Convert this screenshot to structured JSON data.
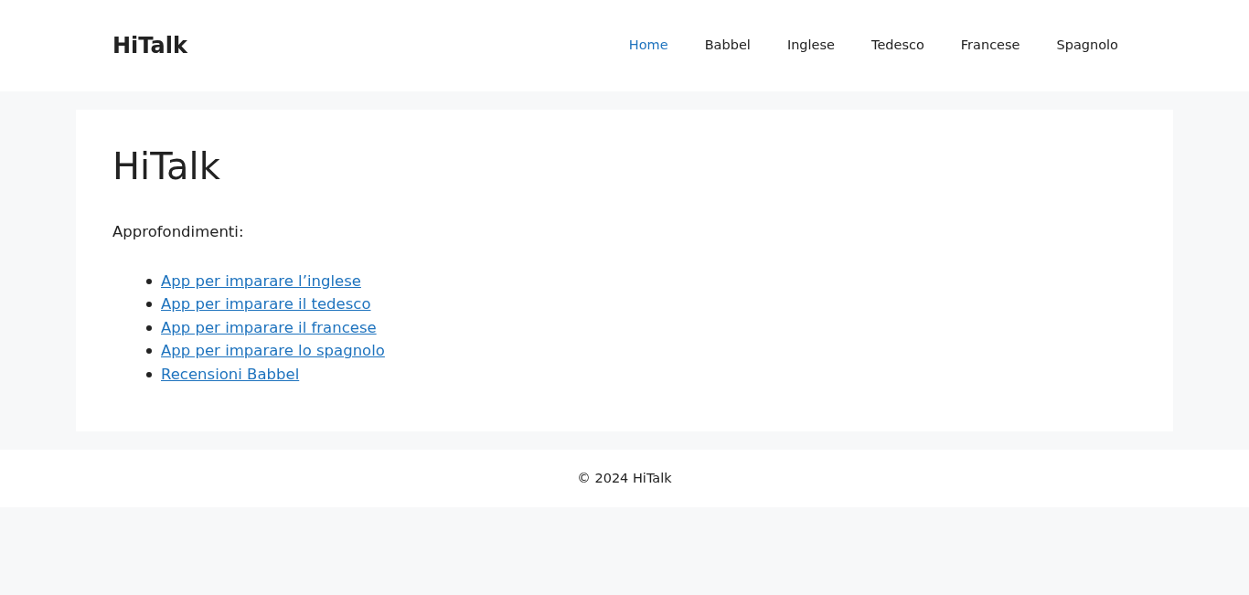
{
  "header": {
    "logo": "HiTalk",
    "nav": [
      {
        "label": "Home",
        "selected": true
      },
      {
        "label": "Babbel",
        "selected": false
      },
      {
        "label": "Inglese",
        "selected": false
      },
      {
        "label": "Tedesco",
        "selected": false
      },
      {
        "label": "Francese",
        "selected": false
      },
      {
        "label": "Spagnolo",
        "selected": false
      }
    ]
  },
  "content": {
    "title": "HiTalk",
    "intro": "Approfondimenti:",
    "links": [
      "App per imparare l’inglese",
      "App per imparare il tedesco",
      "App per imparare il francese",
      "App per imparare lo spagnolo",
      "Recensioni Babbel"
    ]
  },
  "footer": {
    "copyright": "© 2024 HiTalk"
  }
}
